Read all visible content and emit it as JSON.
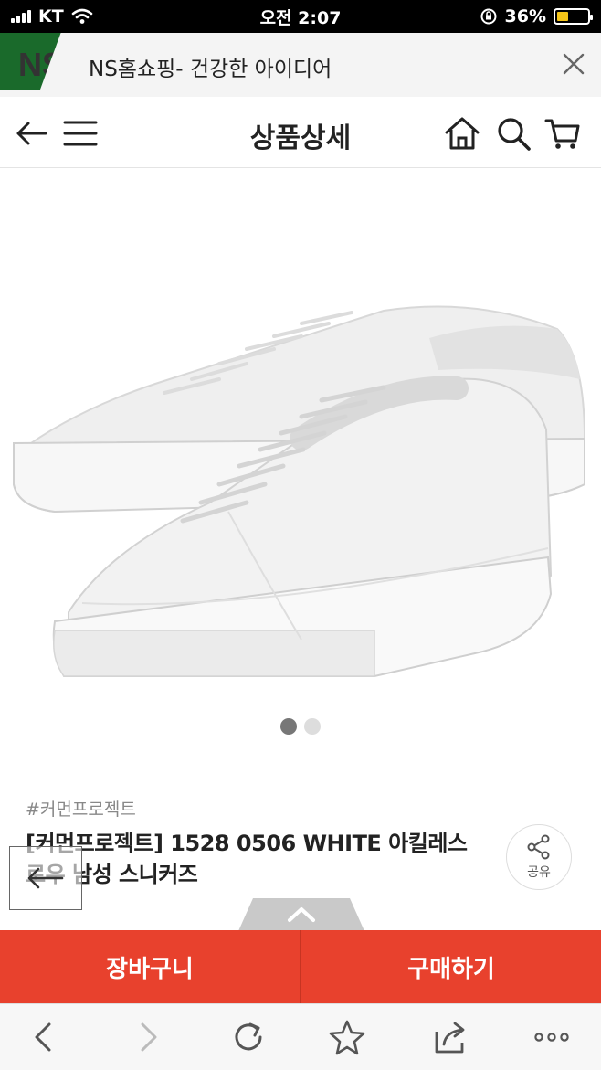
{
  "status_bar": {
    "carrier": "KT",
    "time": "오전 2:07",
    "battery": "36%",
    "battery_level": 0.36,
    "battery_color": "#f5c518"
  },
  "banner": {
    "logo_text": "NS",
    "title": "NS홈쇼핑- 건강한 아이디어",
    "close_icon": "close-icon"
  },
  "header": {
    "title": "상품상세",
    "icons": [
      "back-arrow-icon",
      "menu-icon",
      "home-icon",
      "search-icon",
      "cart-icon"
    ]
  },
  "gallery": {
    "image_alt": "white leather low-top sneakers",
    "pages": 2,
    "current_page": 1
  },
  "product": {
    "brand_tag": "#커먼프로젝트",
    "name": "[커먼프로젝트] 1528 0506 WHITE 아킬레스 로우 남성 스니커즈",
    "share_label": "공유"
  },
  "actions": {
    "cart_label": "장바구니",
    "buy_label": "구매하기",
    "accent_color": "#e8412d"
  },
  "browser": {
    "icons": [
      "back-icon",
      "forward-icon",
      "refresh-icon",
      "bookmark-star-icon",
      "share-icon",
      "more-icon"
    ]
  }
}
